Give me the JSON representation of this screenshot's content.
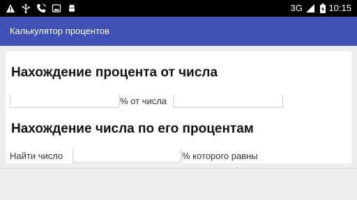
{
  "status_bar": {
    "network": "3G",
    "time": "10:15",
    "icons": [
      "warning-icon",
      "usb-icon",
      "phone-icon",
      "image-icon",
      "android-icon",
      "signal-icon",
      "battery-icon"
    ]
  },
  "app_bar": {
    "title": "Калькулятор процентов",
    "color": "#3f51b5"
  },
  "section_percent_of_number": {
    "heading": "Нахождение процента от числа",
    "percent_input": {
      "value": "",
      "placeholder": ""
    },
    "label_mid": "% от числа",
    "number_input": {
      "value": "",
      "placeholder": ""
    }
  },
  "section_number_by_percent": {
    "heading": "Нахождение числа по его процентам",
    "label_start": "Найти число",
    "value_input": {
      "value": "",
      "placeholder": ""
    },
    "label_end": "% которого равны"
  }
}
